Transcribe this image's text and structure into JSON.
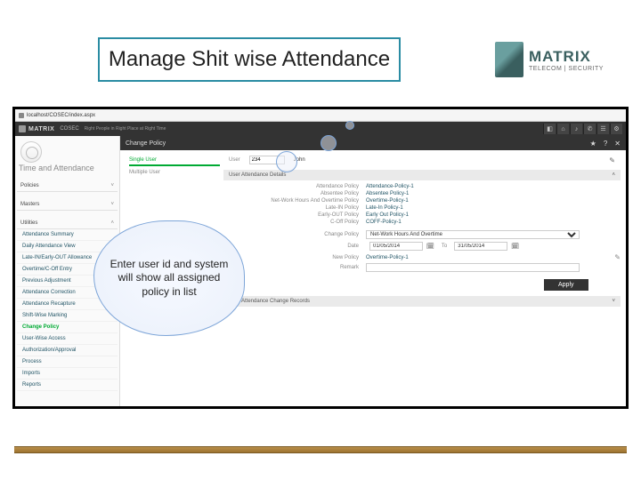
{
  "slide": {
    "title": "Manage Shit wise Attendance"
  },
  "logo": {
    "main": "MATRIX",
    "sub": "TELECOM | SECURITY"
  },
  "urlbar": {
    "text": "localhost/COSEC/index.aspx"
  },
  "topbar": {
    "brand": "MATRIX",
    "product": "COSEC",
    "tagline": "Right People in Right Place at Right Time",
    "icons": [
      "◧",
      "⌂",
      "♪",
      "✆",
      "☰",
      "⚙"
    ]
  },
  "leftnav": {
    "module": "Time and\nAttendance",
    "sections": [
      {
        "label": "Policies",
        "open": false
      },
      {
        "label": "Masters",
        "open": false
      },
      {
        "label": "Utilities",
        "open": true
      }
    ],
    "utilities": [
      "Attendance Summary",
      "Daily Attendance View",
      "Late-IN/Early-OUT Allowance",
      "Overtime/C-Off Entry",
      "Previous Adjustment",
      "Attendance Correction",
      "Attendance Recapture",
      "Shift-Wise Marking",
      "Change Policy",
      "User-Wise Access",
      "Authorization/Approval",
      "Process",
      "Imports",
      "Reports"
    ],
    "active_index": 8
  },
  "panel": {
    "title": "Change Policy",
    "tools": [
      "★",
      "?",
      "✕"
    ]
  },
  "tabs": {
    "items": [
      "Single User",
      "Multiple User"
    ],
    "active": 0
  },
  "userline": {
    "label": "User",
    "id": "234",
    "name": "John",
    "edit_icon": "✎"
  },
  "detail_header": "User Attendance Details",
  "policies": [
    {
      "label": "Attendance Policy",
      "value": "Attendance-Policy-1"
    },
    {
      "label": "Absentee Policy",
      "value": "Absentee Policy-1"
    },
    {
      "label": "Net-Work Hours And Overtime Policy",
      "value": "Overtime-Policy-1"
    },
    {
      "label": "Late-IN Policy",
      "value": "Late-In Policy-1"
    },
    {
      "label": "Early-OUT Policy",
      "value": "Early Out Policy-1"
    },
    {
      "label": "C-Off Policy",
      "value": "COFF-Policy-1"
    }
  ],
  "change": {
    "label": "Change Policy",
    "selected": "Net-Work Hours And Overtime",
    "date_label": "Date",
    "date_from": "01/05/2014",
    "date_to_label": "To",
    "date_to": "31/05/2014",
    "new_label": "New Policy",
    "new_value": "Overtime-Policy-1",
    "remark_label": "Remark",
    "apply": "Apply"
  },
  "records_header": "User Attendance Change Records",
  "callout": {
    "text": "Enter user id and system will show all assigned policy in list"
  }
}
